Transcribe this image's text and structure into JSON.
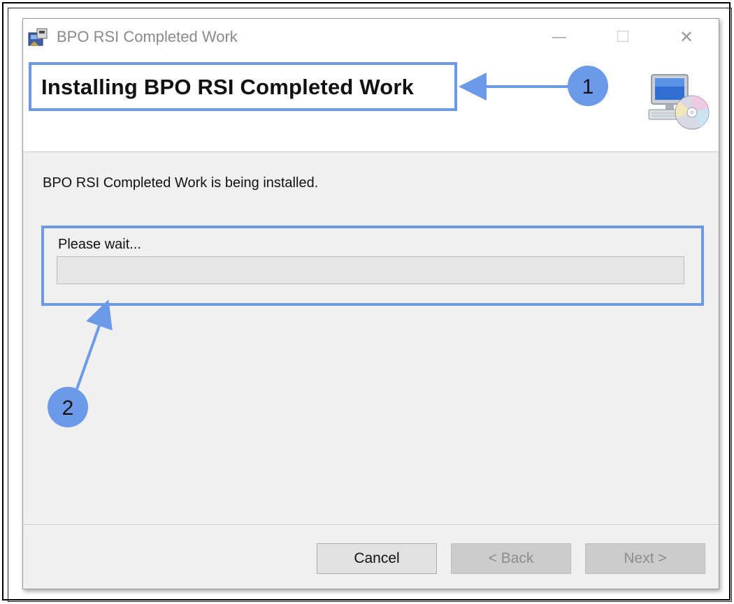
{
  "window": {
    "title": "BPO RSI Completed Work",
    "minimize_glyph": "—",
    "maximize_glyph": "☐",
    "close_glyph": "✕"
  },
  "header": {
    "title": "Installing BPO RSI Completed Work",
    "icon": "computer-cd-icon"
  },
  "content": {
    "status_text": "BPO RSI Completed Work is being installed.",
    "wait_label": "Please wait...",
    "progress_fraction": 0
  },
  "buttons": {
    "cancel": "Cancel",
    "back": "< Back",
    "next": "Next >"
  },
  "annotations": {
    "callout_1": "1",
    "callout_2": "2",
    "accent_color": "#6c9ae8"
  }
}
